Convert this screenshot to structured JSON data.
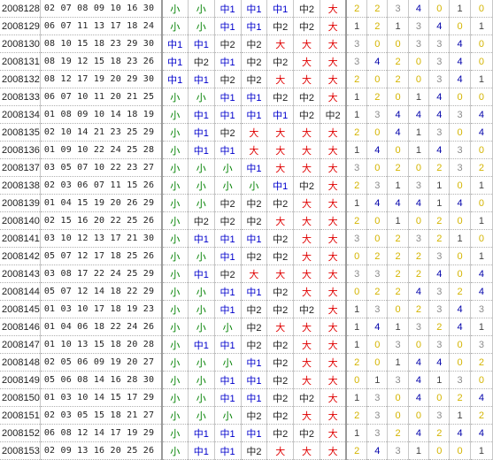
{
  "colors": {
    "small": "#008000",
    "mid": "#0000cc",
    "mid2": "#222222",
    "big": "#e00000",
    "zero_yellow": "#d4b400",
    "count_gray": "#8c8c8c",
    "count_blue": "#0000aa",
    "count_dark": "#444444"
  },
  "rows": [
    {
      "issue": "2008128",
      "nums": "02 07 08 09 10 16 30",
      "z": [
        "小",
        "小",
        "中1",
        "中1",
        "中1",
        "中2",
        "大"
      ],
      "c": [
        "2",
        "2",
        "3",
        "4",
        "0",
        "1",
        "0"
      ]
    },
    {
      "issue": "2008129",
      "nums": "06 07 11 13 17 18 24",
      "z": [
        "小",
        "小",
        "中1",
        "中1",
        "中2",
        "中2",
        "大"
      ],
      "c": [
        "1",
        "2",
        "1",
        "3",
        "4",
        "0",
        "1"
      ]
    },
    {
      "issue": "2008130",
      "nums": "08 10 15 18 23 29 30",
      "z": [
        "中1",
        "中1",
        "中2",
        "中2",
        "大",
        "大",
        "大"
      ],
      "c": [
        "3",
        "0",
        "0",
        "3",
        "3",
        "4",
        "0"
      ]
    },
    {
      "issue": "2008131",
      "nums": "08 19 12 15 18 23 26",
      "z": [
        "中1",
        "中2",
        "中1",
        "中2",
        "中2",
        "大",
        "大"
      ],
      "c": [
        "3",
        "4",
        "2",
        "0",
        "3",
        "4",
        "0"
      ]
    },
    {
      "issue": "2008132",
      "nums": "08 12 17 19 20 29 30",
      "z": [
        "中1",
        "中1",
        "中2",
        "中2",
        "大",
        "大",
        "大"
      ],
      "c": [
        "2",
        "0",
        "2",
        "0",
        "3",
        "4",
        "1"
      ]
    },
    {
      "issue": "2008133",
      "nums": "06 07 10 11 20 21 25",
      "z": [
        "小",
        "小",
        "中1",
        "中1",
        "中2",
        "中2",
        "大"
      ],
      "c": [
        "1",
        "2",
        "0",
        "1",
        "4",
        "0",
        "0"
      ]
    },
    {
      "issue": "2008134",
      "nums": "01 08 09 10 14 18 19",
      "z": [
        "小",
        "中1",
        "中1",
        "中1",
        "中1",
        "中2",
        "中2"
      ],
      "c": [
        "1",
        "3",
        "4",
        "4",
        "4",
        "3",
        "4"
      ]
    },
    {
      "issue": "2008135",
      "nums": "02 10 14 21 23 25 29",
      "z": [
        "小",
        "中1",
        "中2",
        "大",
        "大",
        "大",
        "大"
      ],
      "c": [
        "2",
        "0",
        "4",
        "1",
        "3",
        "0",
        "4"
      ]
    },
    {
      "issue": "2008136",
      "nums": "01 09 10 22 24 25 28",
      "z": [
        "小",
        "中1",
        "中1",
        "大",
        "大",
        "大",
        "大"
      ],
      "c": [
        "1",
        "4",
        "0",
        "1",
        "4",
        "3",
        "0"
      ]
    },
    {
      "issue": "2008137",
      "nums": "03 05 07 10 22 23 27",
      "z": [
        "小",
        "小",
        "小",
        "中1",
        "大",
        "大",
        "大"
      ],
      "c": [
        "3",
        "0",
        "2",
        "0",
        "2",
        "3",
        "2"
      ]
    },
    {
      "issue": "2008138",
      "nums": "02 03 06 07 11 15 26",
      "z": [
        "小",
        "小",
        "小",
        "小",
        "中1",
        "中2",
        "大"
      ],
      "c": [
        "2",
        "3",
        "1",
        "3",
        "1",
        "0",
        "1"
      ]
    },
    {
      "issue": "2008139",
      "nums": "01 04 15 19 20 26 29",
      "z": [
        "小",
        "小",
        "中2",
        "中2",
        "中2",
        "大",
        "大"
      ],
      "c": [
        "1",
        "4",
        "4",
        "4",
        "1",
        "4",
        "0"
      ]
    },
    {
      "issue": "2008140",
      "nums": "02 15 16 20 22 25 26",
      "z": [
        "小",
        "中2",
        "中2",
        "中2",
        "大",
        "大",
        "大"
      ],
      "c": [
        "2",
        "0",
        "1",
        "0",
        "2",
        "0",
        "1"
      ]
    },
    {
      "issue": "2008141",
      "nums": "03 10 12 13 17 21 30",
      "z": [
        "小",
        "中1",
        "中1",
        "中1",
        "中2",
        "大",
        "大"
      ],
      "c": [
        "3",
        "0",
        "2",
        "3",
        "2",
        "1",
        "0"
      ]
    },
    {
      "issue": "2008142",
      "nums": "05 07 12 17 18 25 26",
      "z": [
        "小",
        "小",
        "中1",
        "中2",
        "中2",
        "大",
        "大"
      ],
      "c": [
        "0",
        "2",
        "2",
        "2",
        "3",
        "0",
        "1"
      ]
    },
    {
      "issue": "2008143",
      "nums": "03 08 17 22 24 25 29",
      "z": [
        "小",
        "中1",
        "中2",
        "大",
        "大",
        "大",
        "大"
      ],
      "c": [
        "3",
        "3",
        "2",
        "2",
        "4",
        "0",
        "4"
      ]
    },
    {
      "issue": "2008144",
      "nums": "05 07 12 14 18 22 29",
      "z": [
        "小",
        "小",
        "中1",
        "中1",
        "中2",
        "大",
        "大"
      ],
      "c": [
        "0",
        "2",
        "2",
        "4",
        "3",
        "2",
        "4"
      ]
    },
    {
      "issue": "2008145",
      "nums": "01 03 10 17 18 19 23",
      "z": [
        "小",
        "小",
        "中1",
        "中2",
        "中2",
        "中2",
        "大"
      ],
      "c": [
        "1",
        "3",
        "0",
        "2",
        "3",
        "4",
        "3"
      ]
    },
    {
      "issue": "2008146",
      "nums": "01 04 06 18 22 24 26",
      "z": [
        "小",
        "小",
        "小",
        "中2",
        "大",
        "大",
        "大"
      ],
      "c": [
        "1",
        "4",
        "1",
        "3",
        "2",
        "4",
        "1"
      ]
    },
    {
      "issue": "2008147",
      "nums": "01 10 13 15 18 20 28",
      "z": [
        "小",
        "中1",
        "中1",
        "中2",
        "中2",
        "大",
        "大"
      ],
      "c": [
        "1",
        "0",
        "3",
        "0",
        "3",
        "0",
        "3"
      ]
    },
    {
      "issue": "2008148",
      "nums": "02 05 06 09 19 20 27",
      "z": [
        "小",
        "小",
        "小",
        "中1",
        "中2",
        "大",
        "大"
      ],
      "c": [
        "2",
        "0",
        "1",
        "4",
        "4",
        "0",
        "2"
      ]
    },
    {
      "issue": "2008149",
      "nums": "05 06 08 14 16 28 30",
      "z": [
        "小",
        "小",
        "中1",
        "中1",
        "中2",
        "大",
        "大"
      ],
      "c": [
        "0",
        "1",
        "3",
        "4",
        "1",
        "3",
        "0"
      ]
    },
    {
      "issue": "2008150",
      "nums": "01 03 10 14 15 17 29",
      "z": [
        "小",
        "小",
        "中1",
        "中1",
        "中2",
        "中2",
        "大"
      ],
      "c": [
        "1",
        "3",
        "0",
        "4",
        "0",
        "2",
        "4"
      ]
    },
    {
      "issue": "2008151",
      "nums": "02 03 05 15 18 21 27",
      "z": [
        "小",
        "小",
        "小",
        "中2",
        "中2",
        "大",
        "大"
      ],
      "c": [
        "2",
        "3",
        "0",
        "0",
        "3",
        "1",
        "2"
      ]
    },
    {
      "issue": "2008152",
      "nums": "06 08 12 14 17 19 29",
      "z": [
        "小",
        "中1",
        "中1",
        "中1",
        "中2",
        "中2",
        "大"
      ],
      "c": [
        "1",
        "3",
        "2",
        "4",
        "2",
        "4",
        "4"
      ]
    },
    {
      "issue": "2008153",
      "nums": "02 09 13 16 20 25 26",
      "z": [
        "小",
        "中1",
        "中1",
        "中2",
        "大",
        "大",
        "大"
      ],
      "c": [
        "2",
        "4",
        "3",
        "1",
        "0",
        "0",
        "1"
      ]
    }
  ]
}
